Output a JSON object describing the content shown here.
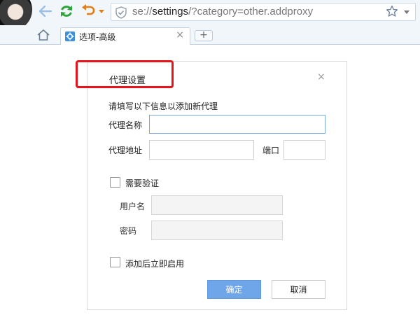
{
  "browser": {
    "url_scheme": "se://",
    "url_host": "settings",
    "url_path": "/?category=other.addproxy",
    "tab_title": "选项-高级",
    "tab_close": "×",
    "new_tab": "+",
    "icons": [
      "avatar",
      "back-arrow-icon",
      "refresh-icon",
      "undo-icon",
      "shield-icon",
      "star-icon",
      "home-icon",
      "gear-icon"
    ]
  },
  "dialog": {
    "title": "代理设置",
    "close": "×",
    "instructions": "请填写以下信息以添加新代理",
    "name_label": "代理名称",
    "name_value": "",
    "address_label": "代理地址",
    "address_value": "",
    "port_label": "端口",
    "port_value": "",
    "auth_label": "需要验证",
    "auth_checked": false,
    "username_label": "用户名",
    "password_label": "密码",
    "enable_label": "添加后立即启用",
    "enable_checked": false,
    "ok_label": "确定",
    "cancel_label": "取消"
  },
  "colors": {
    "highlight": "#e8141b",
    "primary_button": "#6ea6e9",
    "focus_border": "#7aa7d6"
  }
}
